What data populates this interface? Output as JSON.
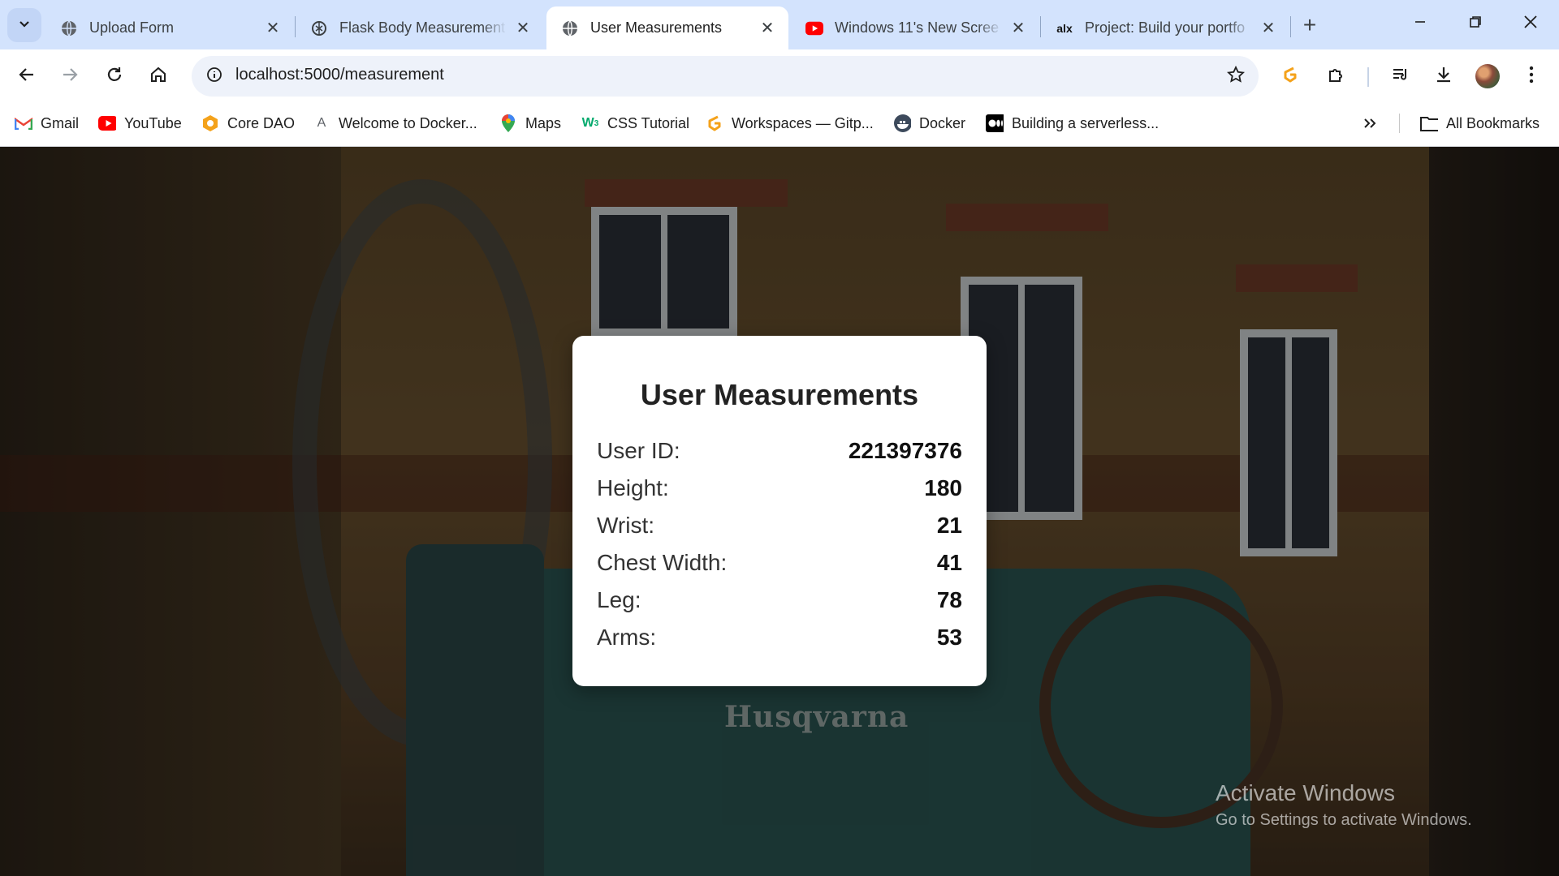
{
  "browser": {
    "tabs": [
      {
        "title": "Upload Form",
        "icon": "globe-icon",
        "active": false
      },
      {
        "title": "Flask Body Measurement",
        "icon": "chatgpt-icon",
        "active": false
      },
      {
        "title": "User Measurements",
        "icon": "globe-icon",
        "active": true
      },
      {
        "title": "Windows 11's New Scree",
        "icon": "youtube-icon",
        "active": false
      },
      {
        "title": "Project: Build your portfo",
        "icon": "alx-icon",
        "active": false
      }
    ],
    "url": "localhost:5000/measurement",
    "bookmarks": [
      {
        "label": "Gmail",
        "icon": "gmail-icon"
      },
      {
        "label": "YouTube",
        "icon": "youtube-icon"
      },
      {
        "label": "Core DAO",
        "icon": "coredao-icon"
      },
      {
        "label": "Welcome to Docker...",
        "icon": "letter-a-icon"
      },
      {
        "label": "Maps",
        "icon": "maps-pin-icon"
      },
      {
        "label": "CSS Tutorial",
        "icon": "w3schools-icon"
      },
      {
        "label": "Workspaces — Gitp...",
        "icon": "gitpod-icon"
      },
      {
        "label": "Docker",
        "icon": "docker-icon"
      },
      {
        "label": "Building a serverless...",
        "icon": "medium-icon"
      }
    ],
    "all_bookmarks_label": "All Bookmarks"
  },
  "card": {
    "title": "User Measurements",
    "rows": [
      {
        "label": "User ID:",
        "value": "221397376"
      },
      {
        "label": "Height:",
        "value": "180"
      },
      {
        "label": "Wrist:",
        "value": "21"
      },
      {
        "label": "Chest Width:",
        "value": "41"
      },
      {
        "label": "Leg:",
        "value": "78"
      },
      {
        "label": "Arms:",
        "value": "53"
      }
    ]
  },
  "background_text": "Husqvarna",
  "watermark": {
    "line1": "Activate Windows",
    "line2": "Go to Settings to activate Windows."
  },
  "colors": {
    "tabstrip": "#d3e3fd",
    "omnibox": "#eef2fa",
    "youtube_red": "#ff0000",
    "accent_orange": "#f4a21b"
  }
}
